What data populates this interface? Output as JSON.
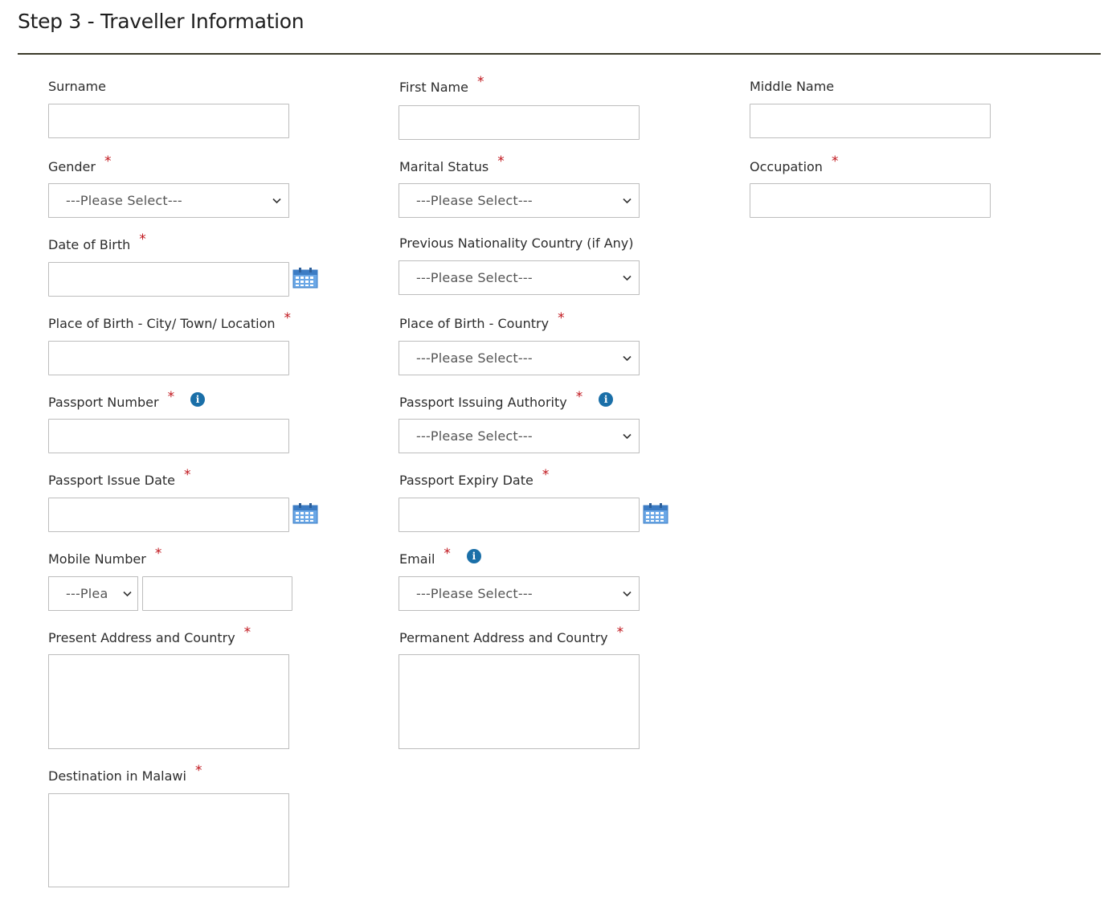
{
  "page": {
    "title": "Step 3 - Traveller Information"
  },
  "labels": {
    "surname": "Surname",
    "first_name": "First Name",
    "middle_name": "Middle Name",
    "gender": "Gender",
    "marital_status": "Marital Status",
    "occupation": "Occupation",
    "dob": "Date of Birth",
    "prev_nationality": "Previous Nationality Country (if Any)",
    "pob_city": "Place of Birth - City/ Town/ Location",
    "pob_country": "Place of Birth - Country",
    "passport_number": "Passport Number",
    "passport_authority": "Passport Issuing Authority",
    "passport_issue": "Passport Issue Date",
    "passport_expiry": "Passport Expiry Date",
    "mobile": "Mobile Number",
    "email": "Email",
    "present_address": "Present Address and Country",
    "permanent_address": "Permanent Address and Country",
    "destination": "Destination in Malawi"
  },
  "required_mark": "*",
  "info_glyph": "i",
  "selects": {
    "placeholder": "---Please Select---",
    "mobile_code_visible": "---Plea"
  },
  "colors": {
    "required": "#c0141b",
    "info": "#1a6fa8",
    "rule": "#3b3a2a",
    "calendar": "#4a8fd6"
  },
  "icons": {
    "calendar": "calendar-icon",
    "info": "info-icon",
    "chevron": "chevron-down-icon"
  }
}
